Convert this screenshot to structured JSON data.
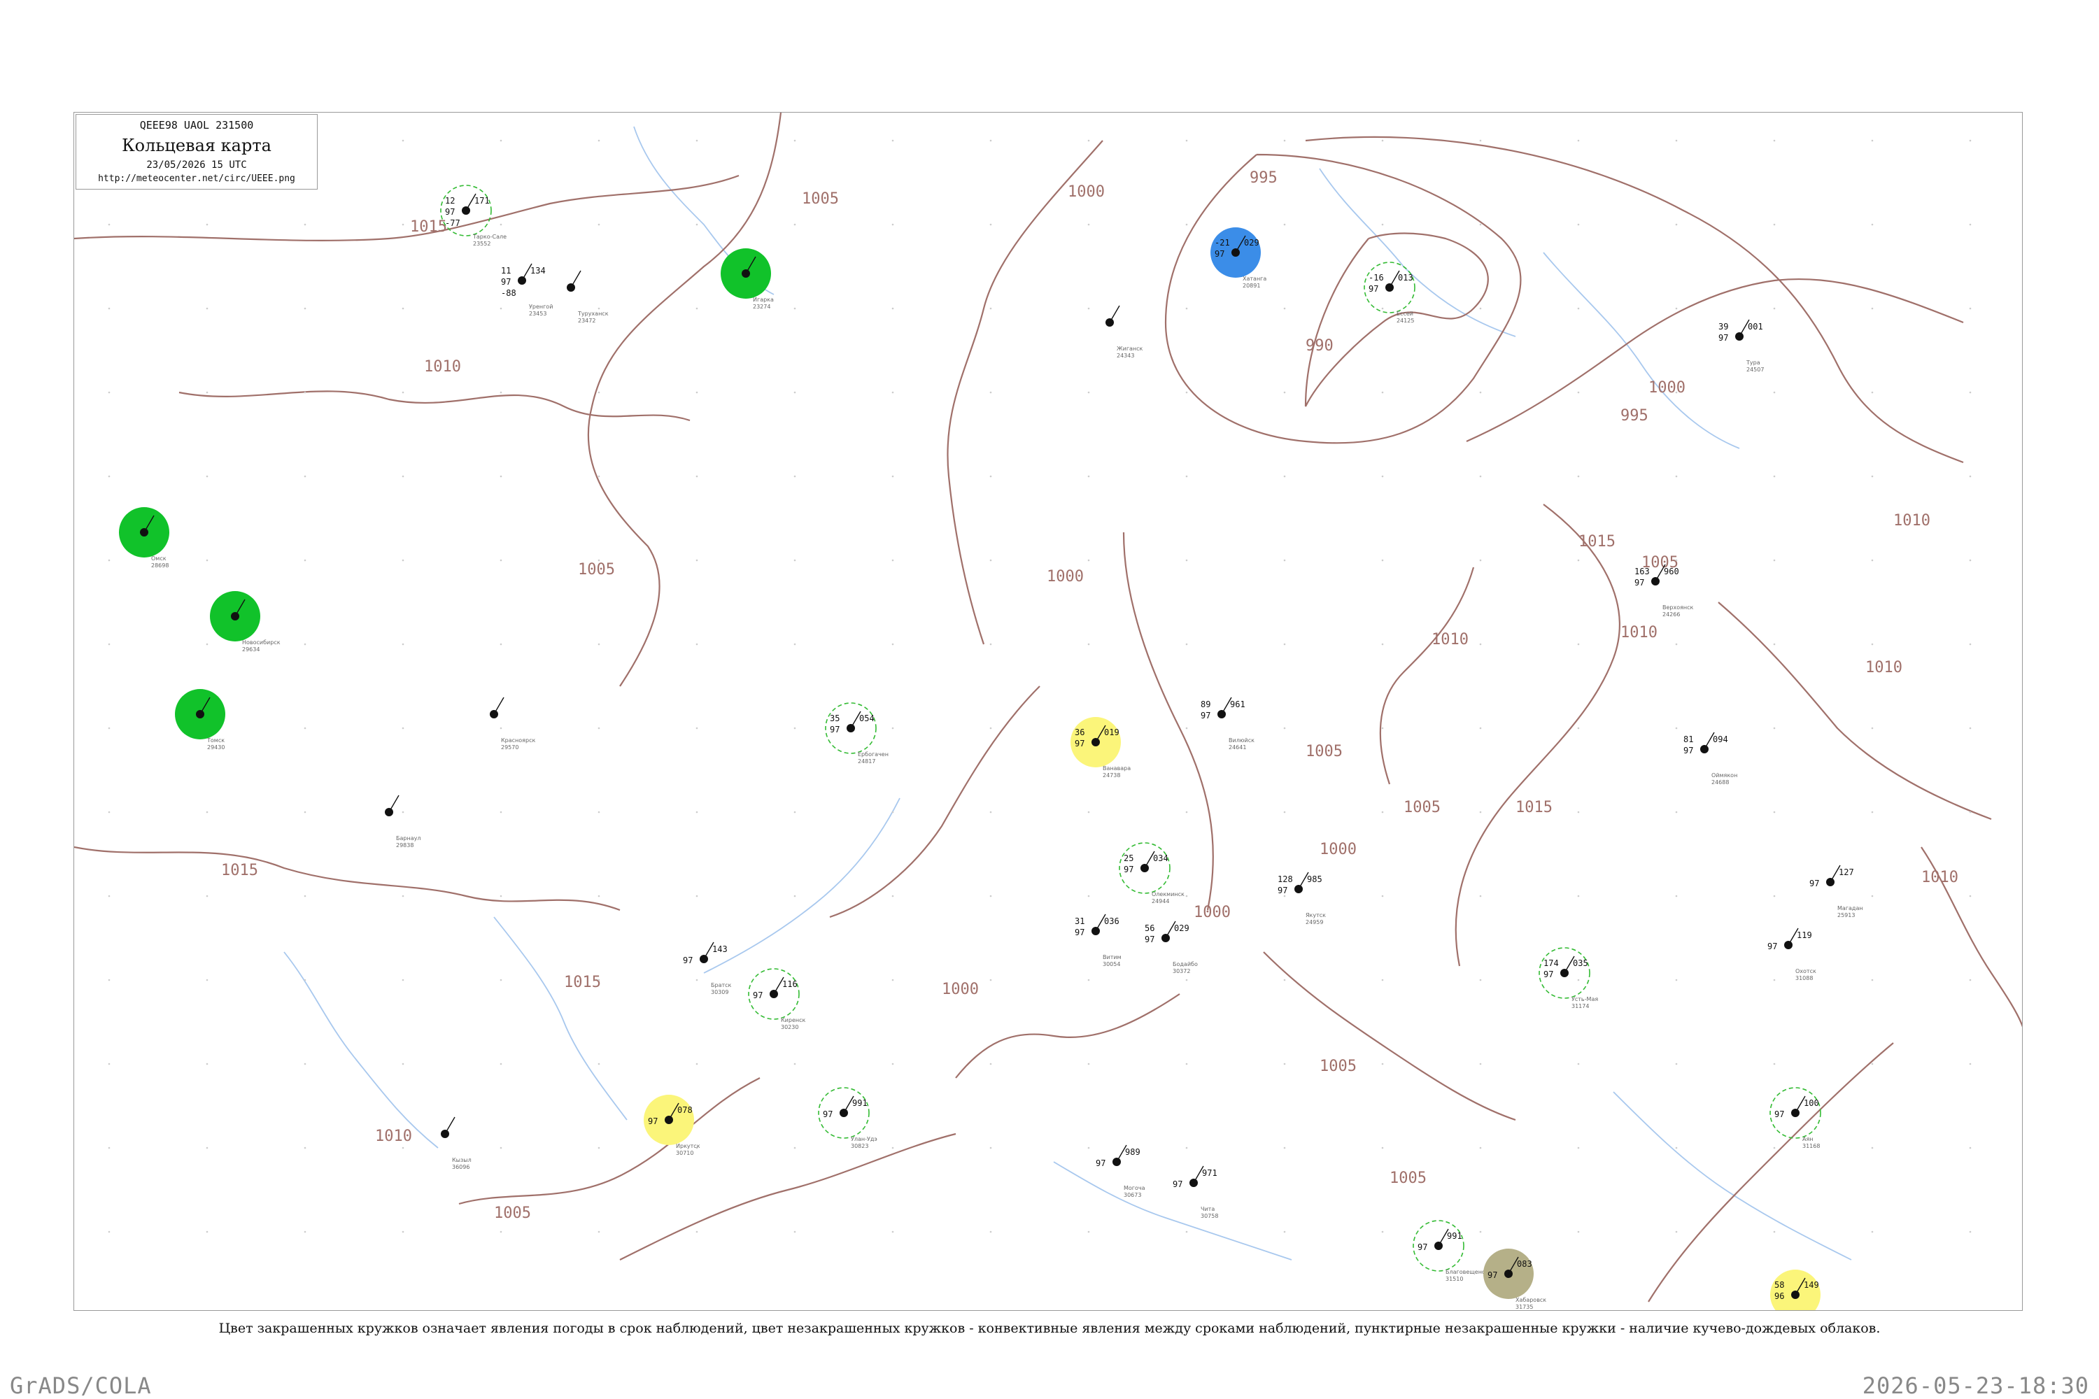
{
  "header": {
    "code": "QEEE98  UAOL  231500",
    "title": "Кольцевая карта",
    "date": "23/05/2026 15 UTC",
    "url": "http://meteocenter.net/circ/UEEE.png"
  },
  "caption": "Цвет закрашенных кружков означает явления погоды в срок наблюдений, цвет незакрашенных кружков - конвективные явления между сроками наблюдений, пунктирные незакрашенные кружки - наличие кучево-дождевых облаков.",
  "footer": {
    "left": "GrADS/COLA",
    "right": "2026-05-23-18:30"
  },
  "colors": {
    "isobar": "#a0706a",
    "river": "#a8c8ee",
    "rain": "#11c22a",
    "shower": "#3b8de8",
    "thunder": "#fbf57a",
    "fog": "#b5b088",
    "ring": "#33bb33"
  },
  "isobar_labels": [
    "1015",
    "1010",
    "1005",
    "1000",
    "995",
    "990",
    "995",
    "1000",
    "1005",
    "1010",
    "1015",
    "1010",
    "1005",
    "1000",
    "1005",
    "1010",
    "1015",
    "1005",
    "1000",
    "1005",
    "1010",
    "1015",
    "1010",
    "1005",
    "1000",
    "1005",
    "1015",
    "1010",
    "1000"
  ],
  "stations": [
    {
      "id": "st1",
      "name": "Тарко-Сале",
      "num": "23552",
      "t": "12",
      "td": "-77",
      "p": "171",
      "vis": "97",
      "phen": ""
    },
    {
      "id": "st2",
      "name": "Уренгой",
      "num": "23453",
      "t": "11",
      "td": "-88",
      "p": "134",
      "vis": "97",
      "phen": ""
    },
    {
      "id": "st3",
      "name": "Туруханск",
      "num": "23472",
      "t": "",
      "td": "",
      "p": "",
      "vis": "",
      "phen": ""
    },
    {
      "id": "st4",
      "name": "Игарка",
      "num": "23274",
      "t": "",
      "td": "",
      "p": "",
      "vis": "",
      "phen": "rain"
    },
    {
      "id": "st5",
      "name": "Хатанга",
      "num": "20891",
      "t": "-21",
      "td": "",
      "p": "029",
      "vis": "97",
      "phen": "shower"
    },
    {
      "id": "st6",
      "name": "Жиганск",
      "num": "24343",
      "t": "",
      "td": "",
      "p": "",
      "vis": "",
      "phen": ""
    },
    {
      "id": "st7",
      "name": "Ессей",
      "num": "24125",
      "t": "-16",
      "td": "",
      "p": "013",
      "vis": "97",
      "phen": ""
    },
    {
      "id": "st8",
      "name": "Тура",
      "num": "24507",
      "t": "39",
      "td": "",
      "p": "001",
      "vis": "97",
      "phen": ""
    },
    {
      "id": "st9",
      "name": "Ванавара",
      "num": "24738",
      "t": "36",
      "td": "",
      "p": "019",
      "vis": "97",
      "phen": "thunder"
    },
    {
      "id": "st10",
      "name": "Ербогачен",
      "num": "24817",
      "t": "35",
      "td": "",
      "p": "054",
      "vis": "97",
      "phen": ""
    },
    {
      "id": "st11",
      "name": "Вилюйск",
      "num": "24641",
      "t": "89",
      "td": "",
      "p": "961",
      "vis": "97",
      "phen": ""
    },
    {
      "id": "st12",
      "name": "Якутск",
      "num": "24959",
      "t": "128",
      "td": "",
      "p": "985",
      "vis": "97",
      "phen": ""
    },
    {
      "id": "st13",
      "name": "Олекминск",
      "num": "24944",
      "t": "25",
      "td": "",
      "p": "034",
      "vis": "97",
      "phen": ""
    },
    {
      "id": "st14",
      "name": "Витим",
      "num": "30054",
      "t": "31",
      "td": "",
      "p": "036",
      "vis": "97",
      "phen": ""
    },
    {
      "id": "st15",
      "name": "Бодайбо",
      "num": "30372",
      "t": "56",
      "td": "",
      "p": "029",
      "vis": "97",
      "phen": ""
    },
    {
      "id": "st16",
      "name": "Киренск",
      "num": "30230",
      "t": "",
      "td": "",
      "p": "116",
      "vis": "97",
      "phen": ""
    },
    {
      "id": "st17",
      "name": "Братск",
      "num": "30309",
      "t": "",
      "td": "",
      "p": "143",
      "vis": "97",
      "phen": ""
    },
    {
      "id": "st18",
      "name": "Иркутск",
      "num": "30710",
      "t": "",
      "td": "",
      "p": "078",
      "vis": "97",
      "phen": "thunder"
    },
    {
      "id": "st19",
      "name": "Улан-Удэ",
      "num": "30823",
      "t": "",
      "td": "",
      "p": "991",
      "vis": "97",
      "phen": ""
    },
    {
      "id": "st20",
      "name": "Чита",
      "num": "30758",
      "t": "",
      "td": "",
      "p": "971",
      "vis": "97",
      "phen": ""
    },
    {
      "id": "st21",
      "name": "Могоча",
      "num": "30673",
      "t": "",
      "td": "",
      "p": "989",
      "vis": "97",
      "phen": ""
    },
    {
      "id": "st22",
      "name": "Благовещенск",
      "num": "31510",
      "t": "",
      "td": "",
      "p": "991",
      "vis": "97",
      "phen": ""
    },
    {
      "id": "st23",
      "name": "Хабаровск",
      "num": "31735",
      "t": "",
      "td": "",
      "p": "083",
      "vis": "97",
      "phen": "fog"
    },
    {
      "id": "st24",
      "name": "Охотск",
      "num": "31088",
      "t": "",
      "td": "",
      "p": "119",
      "vis": "97",
      "phen": ""
    },
    {
      "id": "st25",
      "name": "Аян",
      "num": "31168",
      "t": "",
      "td": "",
      "p": "100",
      "vis": "97",
      "phen": ""
    },
    {
      "id": "st26",
      "name": "Оймякон",
      "num": "24688",
      "t": "81",
      "td": "",
      "p": "094",
      "vis": "97",
      "phen": ""
    },
    {
      "id": "st27",
      "name": "Верхоянск",
      "num": "24266",
      "t": "163",
      "td": "",
      "p": "960",
      "vis": "97",
      "phen": ""
    },
    {
      "id": "st28",
      "name": "Усть-Мая",
      "num": "31174",
      "t": "174",
      "td": "",
      "p": "035",
      "vis": "97",
      "phen": ""
    },
    {
      "id": "st29",
      "name": "Магадан",
      "num": "25913",
      "t": "",
      "td": "",
      "p": "127",
      "vis": "97",
      "phen": ""
    },
    {
      "id": "st30",
      "name": "Николаевск-на-Амуре",
      "num": "31369",
      "t": "58",
      "td": "",
      "p": "149",
      "vis": "96",
      "phen": "thunder"
    },
    {
      "id": "st31",
      "name": "Новосибирск",
      "num": "29634",
      "t": "",
      "td": "",
      "p": "",
      "vis": "",
      "phen": "rain"
    },
    {
      "id": "st32",
      "name": "Омск",
      "num": "28698",
      "t": "",
      "td": "",
      "p": "",
      "vis": "",
      "phen": "rain"
    },
    {
      "id": "st33",
      "name": "Барнаул",
      "num": "29838",
      "t": "",
      "td": "",
      "p": "",
      "vis": "",
      "phen": ""
    },
    {
      "id": "st34",
      "name": "Томск",
      "num": "29430",
      "t": "",
      "td": "",
      "p": "",
      "vis": "",
      "phen": "rain"
    },
    {
      "id": "st35",
      "name": "Красноярск",
      "num": "29570",
      "t": "",
      "td": "",
      "p": "",
      "vis": "",
      "phen": ""
    },
    {
      "id": "st36",
      "name": "Кызыл",
      "num": "36096",
      "t": "",
      "td": "",
      "p": "",
      "vis": "",
      "phen": ""
    }
  ]
}
